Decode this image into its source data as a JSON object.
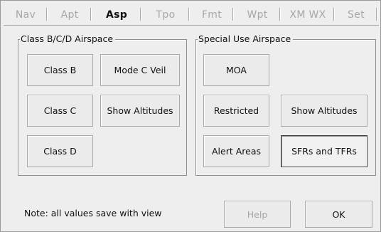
{
  "tabs": [
    {
      "label": "Nav",
      "active": false
    },
    {
      "label": "Apt",
      "active": false
    },
    {
      "label": "Asp",
      "active": true
    },
    {
      "label": "Tpo",
      "active": false
    },
    {
      "label": "Fmt",
      "active": false
    },
    {
      "label": "Wpt",
      "active": false
    },
    {
      "label": "XM WX",
      "active": false
    },
    {
      "label": "Set",
      "active": false
    }
  ],
  "class_group": {
    "title": "Class B/C/D Airspace",
    "buttons": {
      "class_b": "Class B",
      "mode_c_veil": "Mode C Veil",
      "class_c": "Class C",
      "show_altitudes": "Show Altitudes",
      "class_d": "Class D"
    }
  },
  "sua_group": {
    "title": "Special Use Airspace",
    "buttons": {
      "moa": "MOA",
      "restricted": "Restricted",
      "show_altitudes": "Show Altitudes",
      "alert_areas": "Alert Areas",
      "sfrs_tfrs": "SFRs and TFRs"
    }
  },
  "footer": {
    "note": "Note: all values save with view",
    "help_label": "Help",
    "ok_label": "OK"
  }
}
